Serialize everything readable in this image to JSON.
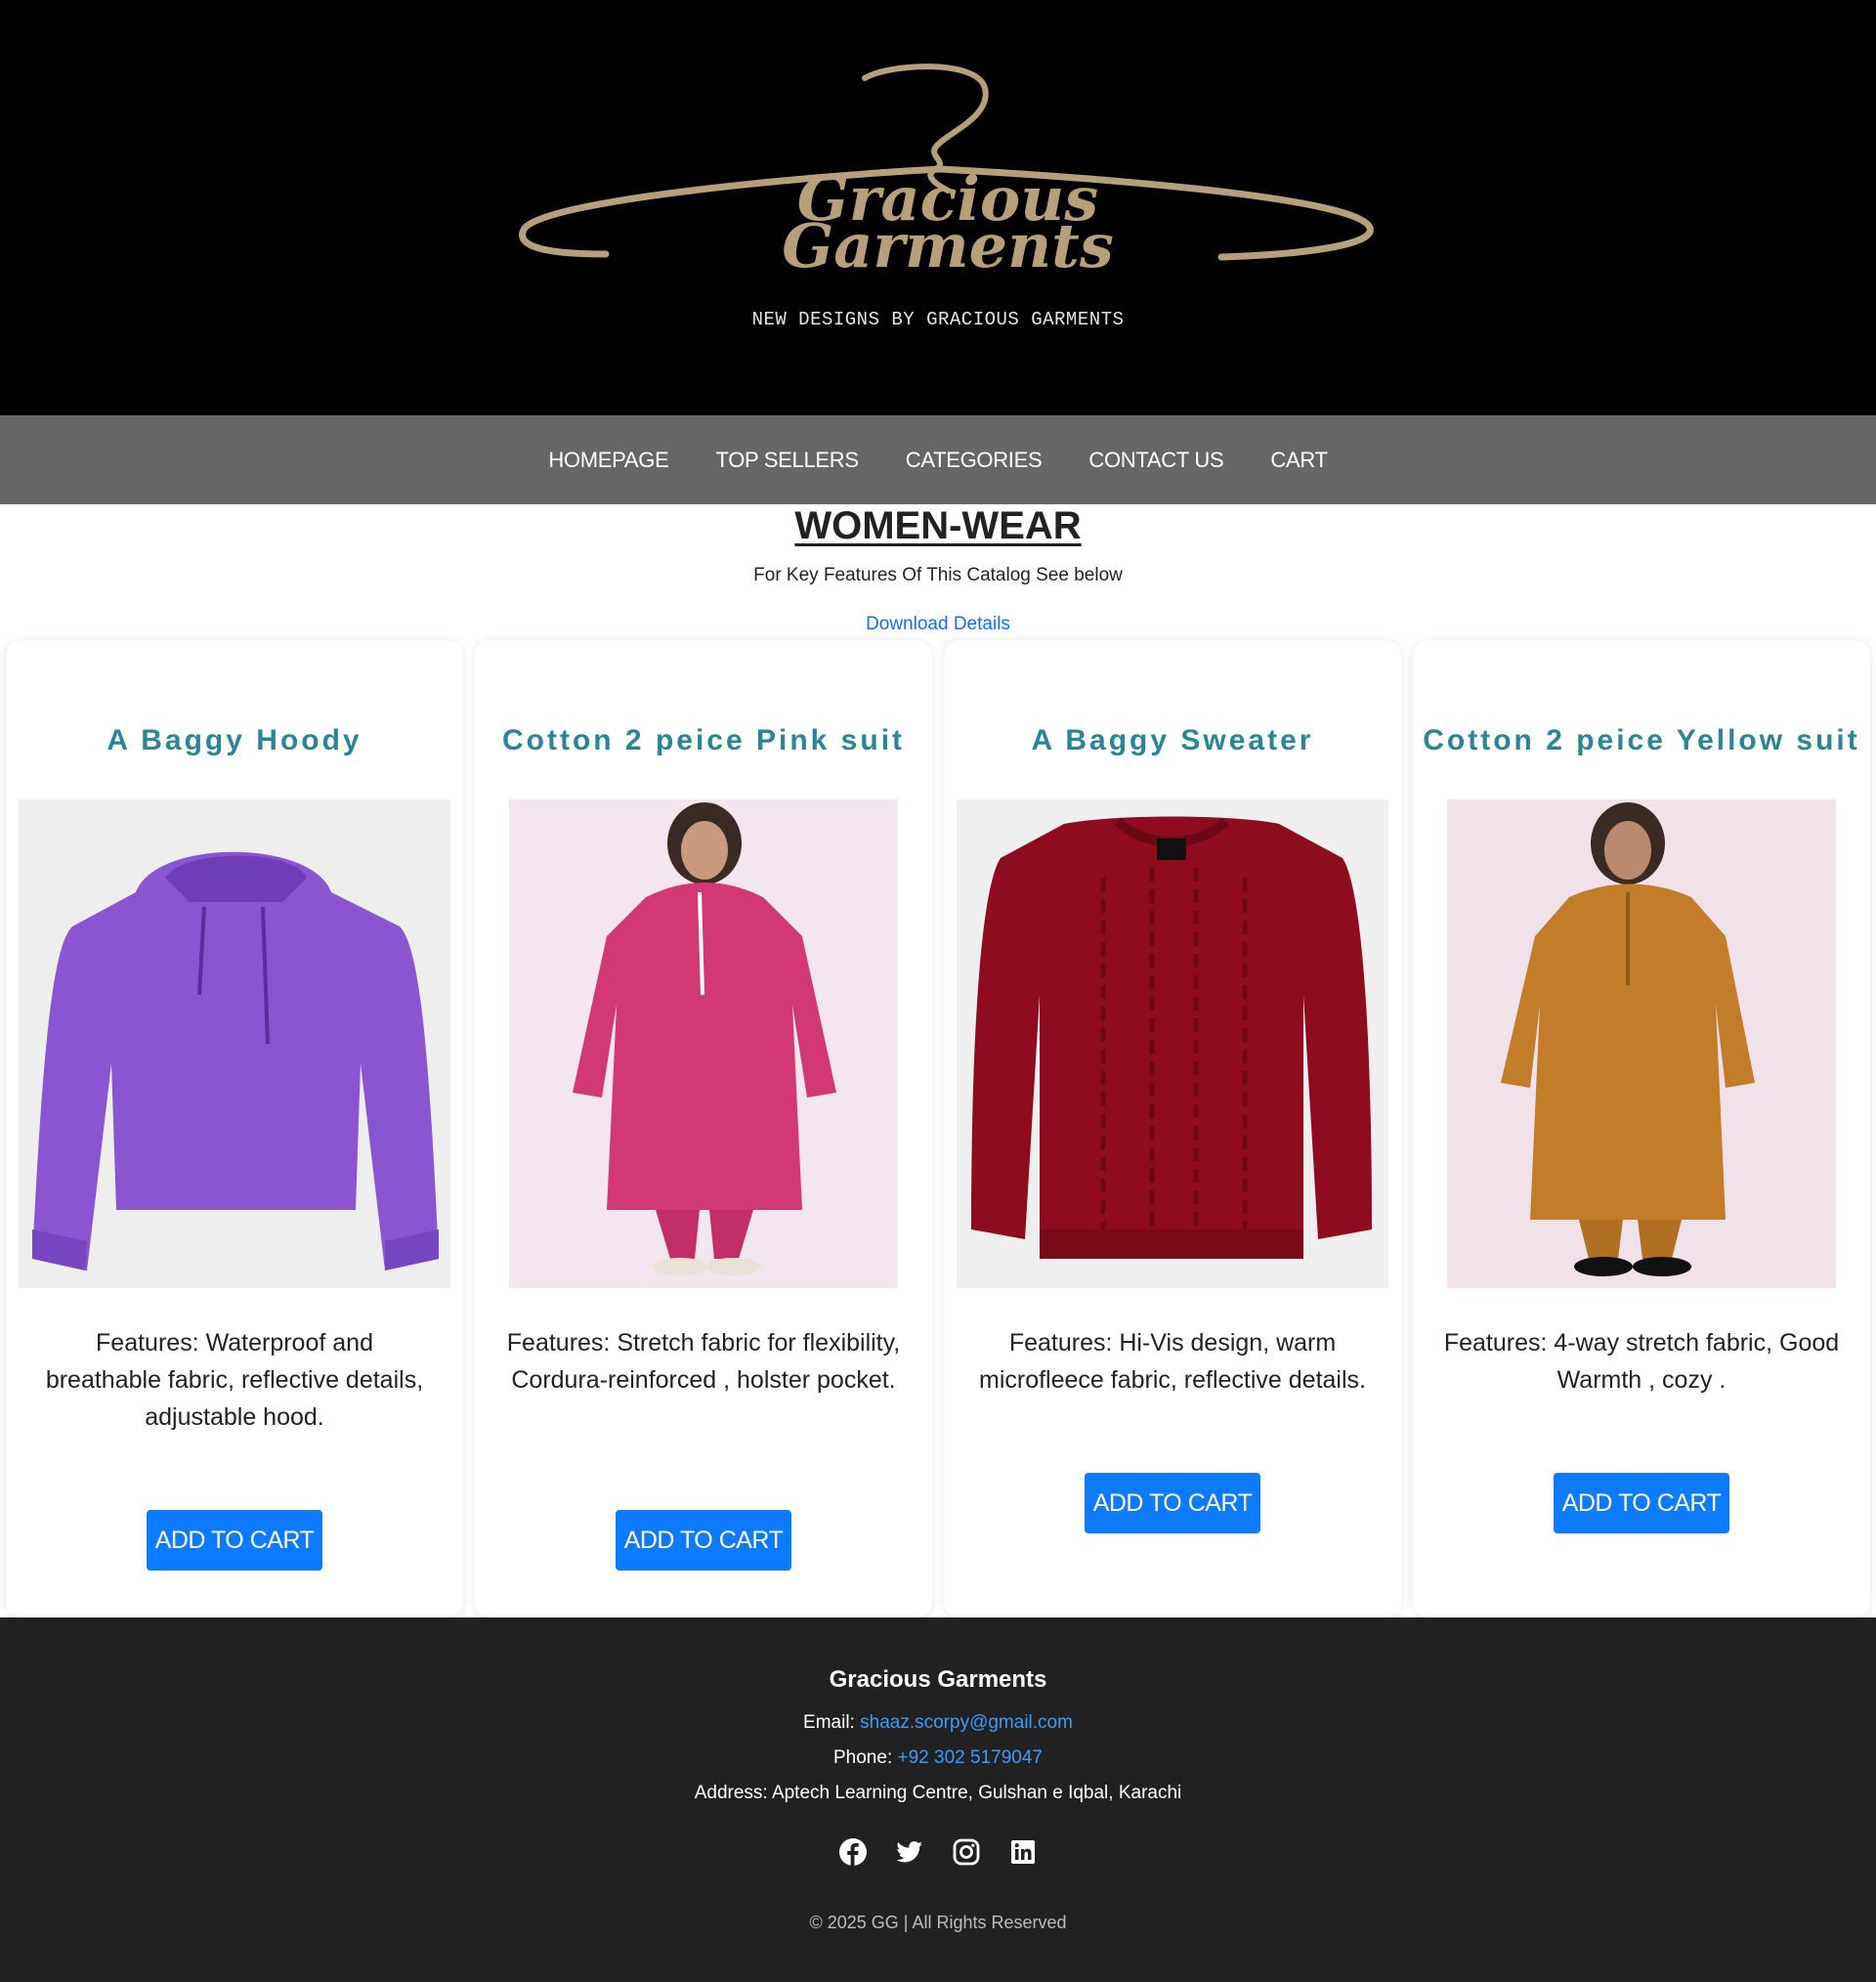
{
  "header": {
    "logo_line1": "Gracious",
    "logo_line2": "Garments",
    "tagline": "NEW DESIGNS BY GRACIOUS GARMENTS"
  },
  "nav": [
    "HOMEPAGE",
    "TOP SELLERS",
    "CATEGORIES",
    "CONTACT US",
    "CART"
  ],
  "main": {
    "title": "WOMEN-WEAR",
    "subtitle": "For Key Features Of This Catalog See below",
    "download_link": "Download Details"
  },
  "products": [
    {
      "title": "A Baggy Hoody",
      "features": "Features: Waterproof and breathable fabric, reflective details, adjustable hood.",
      "button": "ADD TO CART",
      "garment_color": "#8a55d0"
    },
    {
      "title": "Cotton 2 peice Pink suit",
      "features": "Features: Stretch fabric for flexibility, Cordura-reinforced , holster pocket.",
      "button": "ADD TO CART",
      "garment_color": "#d23874"
    },
    {
      "title": "A Baggy Sweater",
      "features": "Features: Hi-Vis design, warm microfleece fabric, reflective details.",
      "button": "ADD TO CART",
      "garment_color": "#8e0c1e"
    },
    {
      "title": "Cotton 2 peice Yellow suit",
      "features": "Features: 4-way stretch fabric, Good Warmth , cozy .",
      "button": "ADD TO CART",
      "garment_color": "#c27c2a"
    }
  ],
  "footer": {
    "brand": "Gracious Garments",
    "email_label": "Email:",
    "email": "shaaz.scorpy@gmail.com",
    "phone_label": "Phone:",
    "phone": "+92 302 5179047",
    "address": "Address: Aptech Learning Centre, Gulshan e Iqbal, Karachi",
    "socials": [
      "facebook-icon",
      "twitter-icon",
      "instagram-icon",
      "linkedin-icon"
    ],
    "copyright": "© 2025 GG | All Rights Reserved"
  },
  "colors": {
    "accent": "#0d7bff",
    "card_title": "#2a8597",
    "nav_bg": "#666666",
    "footer_bg": "#212121",
    "logo_gold": "#b5a079"
  }
}
